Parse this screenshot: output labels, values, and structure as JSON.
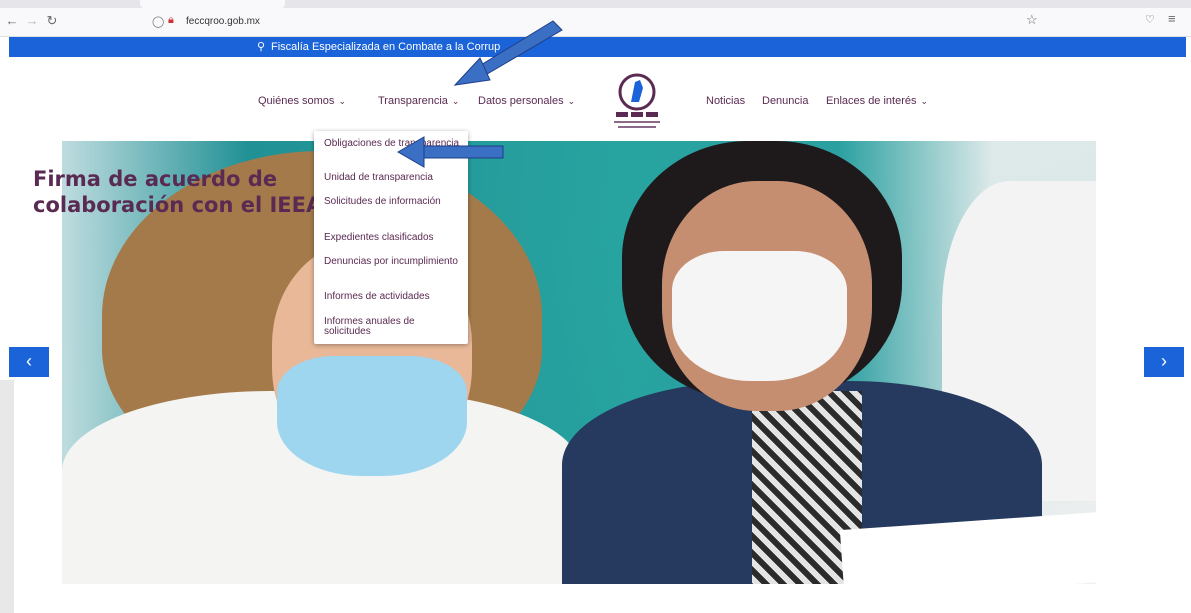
{
  "browser": {
    "url": "feccqroo.gob.mx",
    "icons": {
      "back": "back-arrow-icon",
      "forward": "forward-arrow-icon",
      "reload": "reload-icon",
      "bookmark": "star-icon",
      "pocket": "pocket-icon",
      "menu": "hamburger-menu-icon"
    }
  },
  "topbar": {
    "text": "Fiscalía Especializada en Combate a la Corrup"
  },
  "nav": {
    "items": [
      {
        "label": "Quiénes somos",
        "has_dropdown": true
      },
      {
        "label": "Transparencia",
        "has_dropdown": true
      },
      {
        "label": "Datos personales",
        "has_dropdown": true
      },
      {
        "label": "Noticias",
        "has_dropdown": false
      },
      {
        "label": "Denuncia",
        "has_dropdown": false
      },
      {
        "label": "Enlaces de interés",
        "has_dropdown": true
      }
    ],
    "chevron": "⌄"
  },
  "dropdown": {
    "items": [
      "Obligaciones de transparencia",
      "Unidad de transparencia",
      "Solicitudes de información",
      "Expedientes clasificados",
      "Denuncias por incumplimiento",
      "Informes de actividades",
      "Informes anuales de solicitudes"
    ]
  },
  "hero": {
    "title": "Firma de acuerdo de colaboración con el IEEA"
  },
  "slider": {
    "prev": "‹",
    "next": "›"
  },
  "colors": {
    "brand_blue": "#1a63d9",
    "brand_purple": "#5a2a52",
    "annotation_arrow": "#3a6fc4"
  }
}
